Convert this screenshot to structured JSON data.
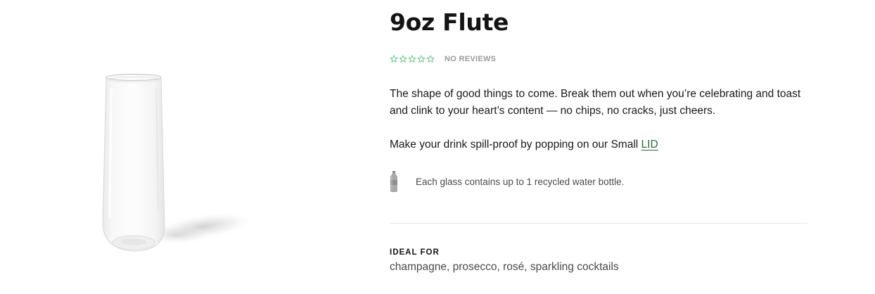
{
  "product": {
    "title": "9oz Flute",
    "rating": {
      "stars_filled": 0,
      "stars_total": 5,
      "star_color": "#5cc07a",
      "reviews_label": "NO REVIEWS"
    },
    "description": "The shape of good things to come. Break them out when you’re celebrating and toast and clink to your heart’s content — no chips, no cracks, just cheers.",
    "lid_line": {
      "prefix": "Make your drink spill-proof by popping on our Small ",
      "link_label": "LID",
      "link_color": "#2a6a3a"
    },
    "recycle": {
      "icon": "water-bottle-icon",
      "text": "Each glass contains up to 1 recycled water bottle."
    },
    "ideal_for": {
      "label": "IDEAL FOR",
      "value": "champagne, prosecco, rosé, sparkling cocktails"
    },
    "image": {
      "icon": "flute-glass-image"
    }
  }
}
